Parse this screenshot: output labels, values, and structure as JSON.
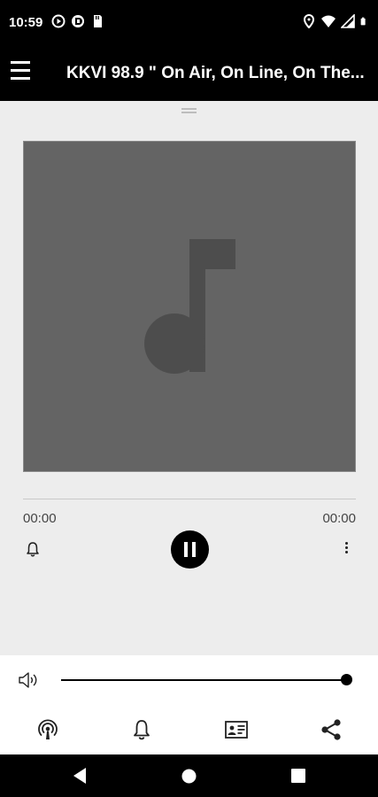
{
  "status_bar": {
    "time": "10:59",
    "left_icons": [
      "play-circle-icon",
      "dnd-icon",
      "sim-card-icon"
    ],
    "right_icons": [
      "location-icon",
      "wifi-icon",
      "signal-icon",
      "battery-icon"
    ]
  },
  "app_bar": {
    "title": "KKVI 98.9 \" On Air, On Line, On The...",
    "menu_icon": "hamburger-menu-icon"
  },
  "player": {
    "artwork_icon": "music-note-icon",
    "artwork_color": "#646464",
    "progress": 0,
    "time_elapsed": "00:00",
    "time_total": "00:00",
    "state": "playing",
    "controls": [
      "alarm-icon",
      "pause-icon",
      "more-vert-icon"
    ]
  },
  "volume": {
    "level": 1.0,
    "icon": "volume-icon"
  },
  "bottom_nav": [
    "podcast-icon",
    "alarm-icon",
    "contact-card-icon",
    "share-icon"
  ],
  "system_nav": [
    "back-icon",
    "home-icon",
    "recents-icon"
  ]
}
